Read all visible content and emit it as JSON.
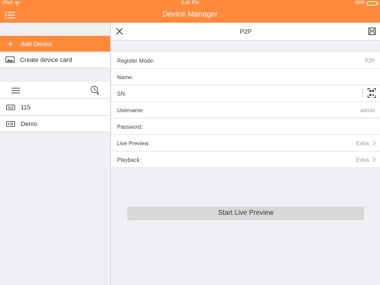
{
  "status_bar": {
    "carrier": "iPad",
    "time": "4:46 PM",
    "battery_percent": "65%"
  },
  "title_bar": {
    "title": "Device Manager"
  },
  "left_panel": {
    "add_device_label": "Add Device",
    "create_card_label": "Create device card",
    "devices": [
      {
        "name": "115"
      },
      {
        "name": "Demo"
      }
    ]
  },
  "right_panel": {
    "title": "P2P",
    "fields": {
      "register_mode": {
        "label": "Register Mode:",
        "value": "P2P"
      },
      "name": {
        "label": "Name:",
        "value": ""
      },
      "sn": {
        "label": "SN:",
        "value": ""
      },
      "username": {
        "label": "Username:",
        "value": "admin"
      },
      "password": {
        "label": "Password:",
        "value": ""
      },
      "live_preview": {
        "label": "Live Preview:",
        "value": "Extra"
      },
      "playback": {
        "label": "Playback:",
        "value": "Extra"
      }
    },
    "start_button_label": "Start Live Preview"
  },
  "colors": {
    "accent": "#ff8a3c",
    "background": "#efeff4"
  },
  "icons": [
    "wifi-icon",
    "battery-icon",
    "menu-list-icon",
    "plus-icon",
    "image-card-icon",
    "lines-icon",
    "clock-sort-icon",
    "device-icon",
    "close-icon",
    "save-icon",
    "qr-scan-icon",
    "chevron-right-icon"
  ]
}
